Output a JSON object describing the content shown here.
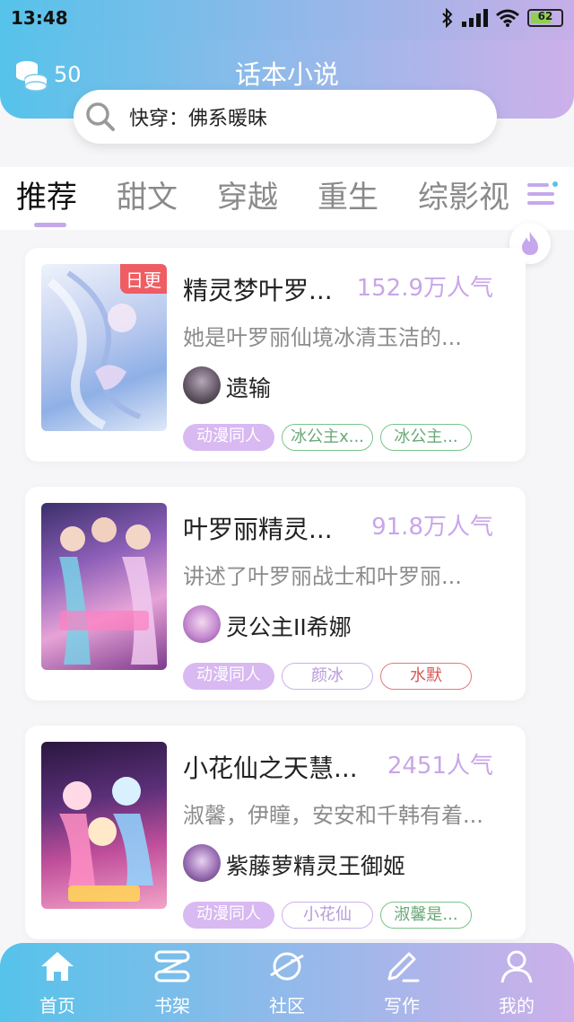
{
  "status": {
    "time": "13:48",
    "battery": "62"
  },
  "header": {
    "coins": "50",
    "title": "话本小说"
  },
  "search": {
    "text": "快穿：佛系暖昧"
  },
  "tabs": [
    {
      "label": "推荐"
    },
    {
      "label": "甜文"
    },
    {
      "label": "穿越"
    },
    {
      "label": "重生"
    },
    {
      "label": "综影视"
    }
  ],
  "books": [
    {
      "badge": "日更",
      "title": "精灵梦叶罗...",
      "popularity": "152.9万人气",
      "desc": "她是叶罗丽仙境冰清玉洁的...",
      "author": "遗输",
      "tags": [
        "动漫同人",
        "冰公主x...",
        "冰公主..."
      ]
    },
    {
      "badge": "",
      "title": "叶罗丽精灵...",
      "popularity": "91.8万人气",
      "desc": "讲述了叶罗丽战士和叶罗丽...",
      "author": "灵公主II希娜",
      "tags": [
        "动漫同人",
        "颜冰",
        "水默"
      ]
    },
    {
      "badge": "",
      "title": "小花仙之天慧...",
      "popularity": "2451人气",
      "desc": "淑馨，伊瞳，安安和千韩有着...",
      "author": "紫藤萝精灵王御姬",
      "tags": [
        "动漫同人",
        "小花仙",
        "淑馨是..."
      ]
    }
  ],
  "nav": [
    {
      "label": "首页",
      "icon": "home-icon"
    },
    {
      "label": "书架",
      "icon": "bookshelf-icon"
    },
    {
      "label": "社区",
      "icon": "planet-icon"
    },
    {
      "label": "写作",
      "icon": "pen-icon"
    },
    {
      "label": "我的",
      "icon": "user-icon"
    }
  ],
  "colors": {
    "accent": "#c5a8ec",
    "gradient_start": "#56c3ea",
    "gradient_end": "#cdb0ea",
    "badge": "#ef5d63"
  }
}
